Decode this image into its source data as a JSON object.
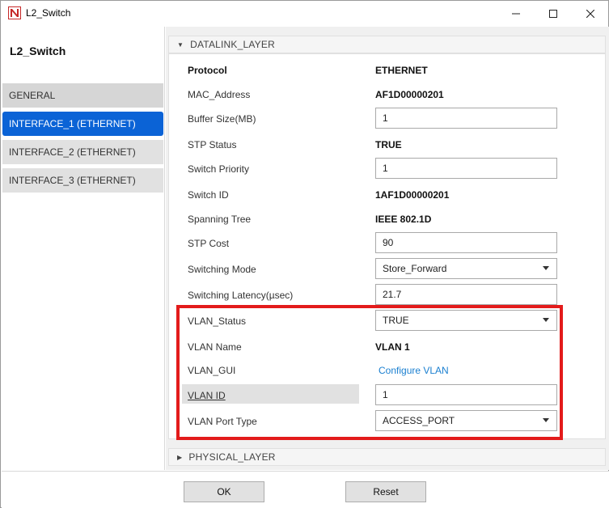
{
  "window": {
    "title": "L2_Switch",
    "icon": "netsim-logo-icon",
    "controls": [
      "minimize-icon",
      "maximize-icon",
      "close-icon"
    ]
  },
  "sidebar": {
    "device_name": "L2_Switch",
    "items": [
      {
        "label": "GENERAL",
        "active": false
      },
      {
        "label": "INTERFACE_1 (ETHERNET)",
        "active": true
      },
      {
        "label": "INTERFACE_2 (ETHERNET)",
        "active": false
      },
      {
        "label": "INTERFACE_3 (ETHERNET)",
        "active": false
      }
    ]
  },
  "datalink": {
    "header": "DATALINK_LAYER",
    "expanded": true,
    "protocol": {
      "label": "Protocol",
      "value": "ETHERNET"
    },
    "mac": {
      "label": "MAC_Address",
      "value": "AF1D00000201"
    },
    "buffer": {
      "label": "Buffer Size(MB)",
      "value": "1"
    },
    "stp_status": {
      "label": "STP Status",
      "value": "TRUE"
    },
    "switch_priority": {
      "label": "Switch Priority",
      "value": "1"
    },
    "switch_id": {
      "label": "Switch ID",
      "value": "1AF1D00000201"
    },
    "spanning_tree": {
      "label": "Spanning Tree",
      "value": "IEEE 802.1D"
    },
    "stp_cost": {
      "label": "STP Cost",
      "value": "90"
    },
    "switching_mode": {
      "label": "Switching Mode",
      "value": "Store_Forward"
    },
    "switching_latency": {
      "label": "Switching Latency(µsec)",
      "value": "21.7"
    },
    "vlan_status": {
      "label": "VLAN_Status",
      "value": "TRUE"
    },
    "vlan_name": {
      "label": "VLAN Name",
      "value": "VLAN 1"
    },
    "vlan_gui": {
      "label": "VLAN_GUI",
      "value": "Configure VLAN"
    },
    "vlan_id": {
      "label": "VLAN ID",
      "value": "1"
    },
    "vlan_port_type": {
      "label": "VLAN Port Type",
      "value": "ACCESS_PORT"
    }
  },
  "physical": {
    "header": "PHYSICAL_LAYER",
    "expanded": false
  },
  "footer": {
    "ok_label": "OK",
    "reset_label": "Reset"
  },
  "colors": {
    "accent": "#0b63d6",
    "highlight_border": "#e31b1b",
    "link": "#1a7fd0"
  }
}
